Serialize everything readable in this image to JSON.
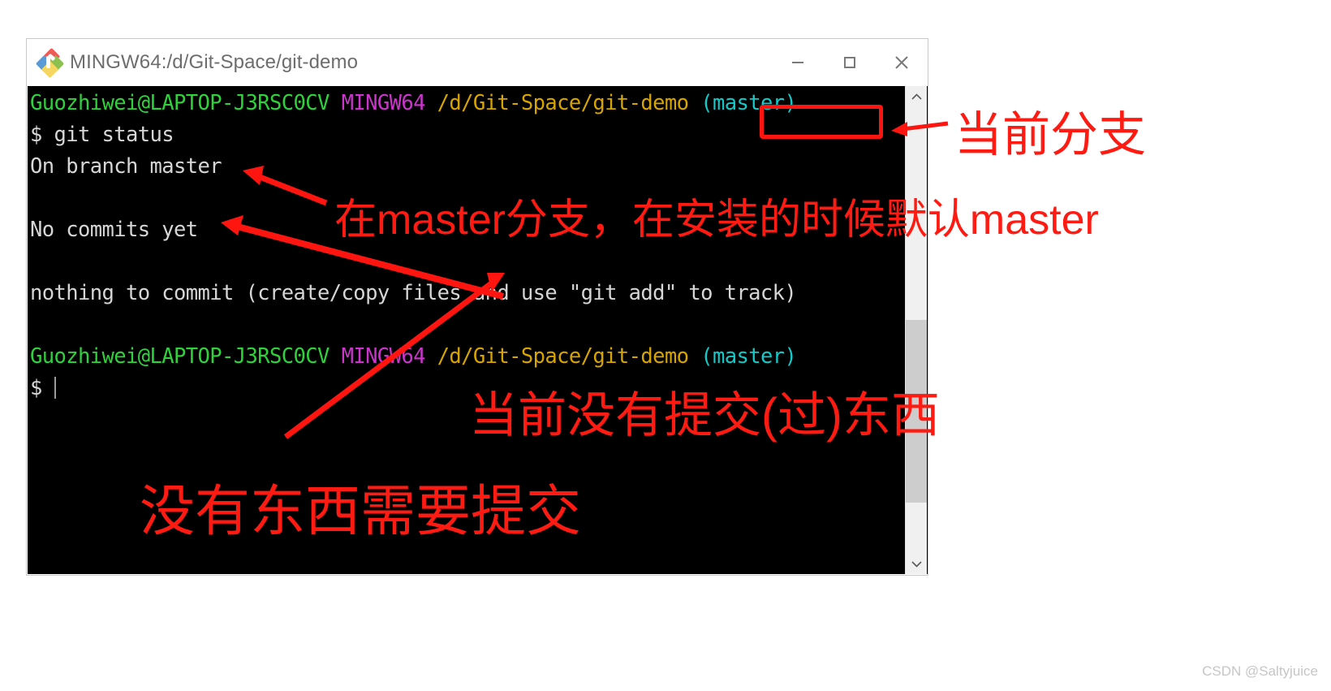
{
  "window": {
    "title": "MINGW64:/d/Git-Space/git-demo",
    "icon": "git-logo-icon",
    "controls": {
      "minimize": "minimize-icon",
      "maximize": "maximize-icon",
      "close": "close-icon"
    }
  },
  "terminal": {
    "lines": [
      {
        "id": "prompt-line-1",
        "segments": [
          {
            "text": "Guozhiwei@LAPTOP-J3RSC0CV",
            "color": "#2fd23a",
            "cls": "c-user"
          },
          {
            "text": " ",
            "color": "#d6d6d6",
            "cls": "c-plain"
          },
          {
            "text": "MINGW64",
            "color": "#cc35cc",
            "cls": "c-host"
          },
          {
            "text": " ",
            "color": "#d6d6d6",
            "cls": "c-plain"
          },
          {
            "text": "/d/Git-Space/git-demo",
            "color": "#d7a400",
            "cls": "c-path"
          },
          {
            "text": " ",
            "color": "#d6d6d6",
            "cls": "c-plain"
          },
          {
            "text": "(master)",
            "color": "#13c9c9",
            "cls": "c-branch"
          }
        ]
      },
      {
        "id": "command-line",
        "segments": [
          {
            "text": "$ git status",
            "color": "#d6d6d6",
            "cls": "c-plain"
          }
        ]
      },
      {
        "id": "output-on-branch",
        "segments": [
          {
            "text": "On branch master",
            "color": "#d6d6d6",
            "cls": "c-plain"
          }
        ]
      },
      {
        "id": "blank-1",
        "segments": [
          {
            "text": " ",
            "color": "#d6d6d6",
            "cls": "c-plain"
          }
        ]
      },
      {
        "id": "output-no-commits",
        "segments": [
          {
            "text": "No commits yet",
            "color": "#d6d6d6",
            "cls": "c-plain"
          }
        ]
      },
      {
        "id": "blank-2",
        "segments": [
          {
            "text": " ",
            "color": "#d6d6d6",
            "cls": "c-plain"
          }
        ]
      },
      {
        "id": "output-nothing-to-commit",
        "segments": [
          {
            "text": "nothing to commit (create/copy files and use \"git add\" to track)",
            "color": "#d6d6d6",
            "cls": "c-plain"
          }
        ]
      },
      {
        "id": "blank-3",
        "segments": [
          {
            "text": " ",
            "color": "#d6d6d6",
            "cls": "c-plain"
          }
        ]
      },
      {
        "id": "prompt-line-2",
        "segments": [
          {
            "text": "Guozhiwei@LAPTOP-J3RSC0CV",
            "color": "#2fd23a",
            "cls": "c-user"
          },
          {
            "text": " ",
            "color": "#d6d6d6",
            "cls": "c-plain"
          },
          {
            "text": "MINGW64",
            "color": "#cc35cc",
            "cls": "c-host"
          },
          {
            "text": " ",
            "color": "#d6d6d6",
            "cls": "c-plain"
          },
          {
            "text": "/d/Git-Space/git-demo",
            "color": "#d7a400",
            "cls": "c-path"
          },
          {
            "text": " ",
            "color": "#d6d6d6",
            "cls": "c-plain"
          },
          {
            "text": "(master)",
            "color": "#13c9c9",
            "cls": "c-branch"
          }
        ]
      },
      {
        "id": "prompt-cursor-line",
        "segments": [
          {
            "text": "$ ",
            "color": "#d6d6d6",
            "cls": "c-plain"
          }
        ],
        "cursor": true
      }
    ],
    "colors": {
      "background": "#000000",
      "foreground": "#d6d6d6",
      "user": "#2fd23a",
      "host": "#cc35cc",
      "path": "#d7a400",
      "branch": "#13c9c9"
    }
  },
  "scrollbar": {
    "up_arrow": "chevron-up-icon",
    "down_arrow": "chevron-down-icon"
  },
  "annotations": {
    "color": "#ff1a12",
    "items": [
      {
        "id": "anno-current-branch",
        "text": "当前分支"
      },
      {
        "id": "anno-on-master",
        "text": "在master分支，在安装的时候默认master"
      },
      {
        "id": "anno-no-commits-made",
        "text": "当前没有提交(过)东西"
      },
      {
        "id": "anno-nothing-to-commit",
        "text": "没有东西需要提交"
      }
    ],
    "highlight_target": "(master)"
  },
  "watermark": {
    "text": "CSDN @Saltyjuice"
  }
}
